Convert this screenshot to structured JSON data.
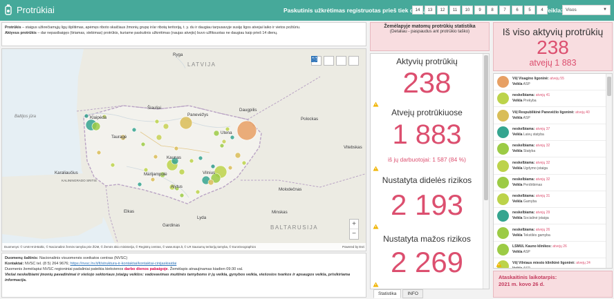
{
  "header": {
    "title": "Protrūkiai",
    "filter_label": "Paskutinis užkrėtimas registruotas prieš tiek dienų:",
    "days": [
      "14",
      "13",
      "12",
      "11",
      "10",
      "9",
      "8",
      "7",
      "6",
      "5",
      "4"
    ],
    "veikla_label": "Veikla:",
    "veikla_value": "Visos"
  },
  "definitions": {
    "line1_term": "Protrūkis",
    "line1_text": " – staigus užkrečiamųjų ligų išplitimas, apėmęs riboto skaičiaus žmonių grupę ir/ar ribotą teritoriją, t. y. du ir daugiau tarpusavyje susiję ligos atvejai laiko ir vietos požiūriu.",
    "line2_term": "Aktyvus protrūkis",
    "line2_text": " – dar nepasibaigęs (tiriamas, stebimas) protrūkis, kuriame paskutinis užkrėtimas (naujas atvejis) buvo užfiksuotas ne daugiau kaip prieš 14 dienų."
  },
  "map": {
    "countries": {
      "latvia": "LATVIJA",
      "belarus": "BALTARUSIJA"
    },
    "cities": [
      "Ryga",
      "Šiauliai",
      "Panevėžys",
      "Daugpilis",
      "Utena",
      "Kaunas",
      "Vilnius",
      "Alytus",
      "Marijampolė",
      "Klaipėda",
      "Tauragė",
      "Vitebskas",
      "Polockas",
      "Karaliaučius",
      "Gardinas",
      "Minskas",
      "Elkas",
      "Lyda",
      "Molodečnas"
    ],
    "seas": [
      "Baltijos jūra"
    ],
    "region": "KALININGRADO SRITIS",
    "attribution": "Duomenys: © UAB Hnit-Baltic, © Nacionalinė žemės tarnyba prie ŽŪM, © Žemės ūkio ministerija, © Registrų centras, © www.stops.lt, © LR Sausumų teritorijų tarnyba, © EuroGeographics",
    "powered": "Powered by Esri",
    "zoom_in": "+",
    "zoom_out": "−",
    "colors": {
      "water": "#e6eff4",
      "land": "#ecebe3",
      "lt": "#f3f2ed",
      "border": "#b9a3c4"
    }
  },
  "source": {
    "l1_label": "Duomenų šaltinis:",
    "l1_text": " Nacionalinis visuomenės sveikatos centras (NVSC)",
    "l2_label": "Kontaktai:",
    "l2_text": " NVSC tel. (8 5) 264 9676; ",
    "l2_link": "https://nvsc.lrv.lt/lt/struktura-ir-kontaktai/kontaktai-cinijaskiaidai",
    "l3_a": "Duomenis žemėlapiui NVSC regioniniai padaliniai pateikia kiekvienos ",
    "l3_red": "darbo dienos pabaigoje",
    "l3_b": ". Žemėlapis atnaujinamas kiadien 09:30 val.",
    "l4": "Viešai neskelbiami įmonių pavadinimai ir viešojo sektoriaus įstaigų veiklos: vadovavimas muitinės tarnyboms ir jų veikla, gynybos veikla, viešosios tvarkos ir apsaugos veikla, prisikiriama informacija."
  },
  "stats_header": {
    "title": "Žemėlapyje matomų protrūkių statistika",
    "sub": "(Detaliau - paspaudus ant protrūkio taško)"
  },
  "stats": {
    "active_label": "Aktyvių protrūkių",
    "active_value": "238",
    "cases_label": "Atvejų protrūkiuose",
    "cases_value": "1 883",
    "workers": "iš jų darbuotojai: 1 587 (84 %)",
    "high_label": "Nustatyta didelės rizikos",
    "high_value": "2 193",
    "low_label": "Nustatyta mažos rizikos",
    "low_value": "2 269"
  },
  "tabs": [
    "Statistika",
    "INFO"
  ],
  "totals": {
    "title": "Iš viso aktyvių protrūkių",
    "value": "238",
    "cases": "atvejų 1 883"
  },
  "outbreaks": [
    {
      "name": "VšĮ Visagino ligoninė",
      "count": "atvejų 55",
      "veikla_label": "Veikla",
      "veikla": "ASP",
      "color": "#e7a064"
    },
    {
      "name": "neskelbiama",
      "count": "atvejų 41",
      "veikla_label": "Veikla",
      "veikla": "Prekyba",
      "color": "#bcd34a"
    },
    {
      "name": "VšĮ Respublikinė Panevėžio ligoninė",
      "count": "atvejų 40",
      "veikla_label": "Veikla",
      "veikla": "ASP",
      "color": "#d9bd57"
    },
    {
      "name": "neskelbiama",
      "count": "atvejų 37",
      "veikla_label": "Veikla",
      "veikla": "Laivų statyba",
      "color": "#35a58f"
    },
    {
      "name": "neskelbiama",
      "count": "atvejų 32",
      "veikla_label": "Veikla",
      "veikla": "Statyba",
      "color": "#9ccb45"
    },
    {
      "name": "neskelbiama",
      "count": "atvejų 32",
      "veikla_label": "Veikla",
      "veikla": "Ugdymo įstaiga",
      "color": "#bcd34a"
    },
    {
      "name": "neskelbiama",
      "count": "atvejų 32",
      "veikla_label": "Veikla",
      "veikla": "Perdirbimas",
      "color": "#9ccb45"
    },
    {
      "name": "neskelbiama",
      "count": "atvejų 31",
      "veikla_label": "Veikla",
      "veikla": "Gamyba",
      "color": "#bcd34a"
    },
    {
      "name": "neskelbiama",
      "count": "atvejų 29",
      "veikla_label": "Veikla",
      "veikla": "Socialinė įstaiga",
      "color": "#35a58f"
    },
    {
      "name": "neskelbiama",
      "count": "atvejų 26",
      "veikla_label": "Veikla",
      "veikla": "Tekstilės gamyba",
      "color": "#9ccb45"
    },
    {
      "name": "LSMUL Kauno klinikos",
      "count": "atvejų 26",
      "veikla_label": "Veikla",
      "veikla": "ASP",
      "color": "#9ccb45"
    },
    {
      "name": "VšĮ Vilniaus miesto klinikinė ligoninė",
      "count": "atvejų 24",
      "veikla_label": "Veikla",
      "veikla": "ASP",
      "color": "#bcd34a"
    }
  ],
  "report": {
    "label": "Ataskaitinis laikotarpis:",
    "date": "2021 m. kovo 26 d."
  }
}
